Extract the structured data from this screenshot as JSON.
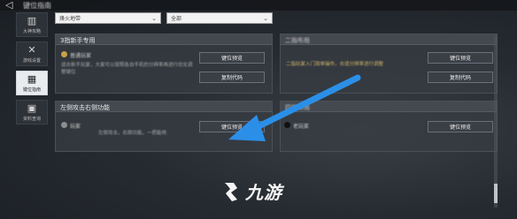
{
  "topbar": {
    "back_glyph": "◁",
    "title": "键位指南"
  },
  "sidebar": {
    "items": [
      {
        "icon": "book-icon",
        "glyph": "▥",
        "label": "大神攻略",
        "active": false
      },
      {
        "icon": "tools-icon",
        "glyph": "✕",
        "label": "游戏设置",
        "active": false
      },
      {
        "icon": "keyboard-icon",
        "glyph": "▦",
        "label": "键位指南",
        "active": true
      },
      {
        "icon": "photo-icon",
        "glyph": "▣",
        "label": "资料查询",
        "active": false
      }
    ]
  },
  "filters": {
    "left": {
      "value": "烽火地带",
      "chevron": "⌄"
    },
    "right": {
      "value": "全部",
      "chevron": "⌄"
    }
  },
  "cards": [
    {
      "title": "3指新手专用",
      "user": "普通玩家",
      "desc": "适合新手玩家，大家可以按照各自手机的分辨率再进行优化调整键位",
      "btn1": "键位预览",
      "btn2": "复制代码"
    },
    {
      "title": "二指布局",
      "user": "",
      "desc": "二指玩家入门简单操作，合适分辨率进行调整",
      "btn1": "键位预览",
      "btn2": "复制代码"
    },
    {
      "title": "左侧攻击右侧功能",
      "user": "玩家",
      "desc": "左侧攻击，右侧功能，一把能用",
      "btn1": "键位预览",
      "btn2": ""
    },
    {
      "title": "四指布局",
      "user": "老玩家",
      "desc": "",
      "btn1": "键位预览",
      "btn2": ""
    }
  ],
  "watermark": {
    "text": "九游"
  },
  "colors": {
    "arrow": "#2b8fe8",
    "active_tab": "#e9ecef"
  }
}
